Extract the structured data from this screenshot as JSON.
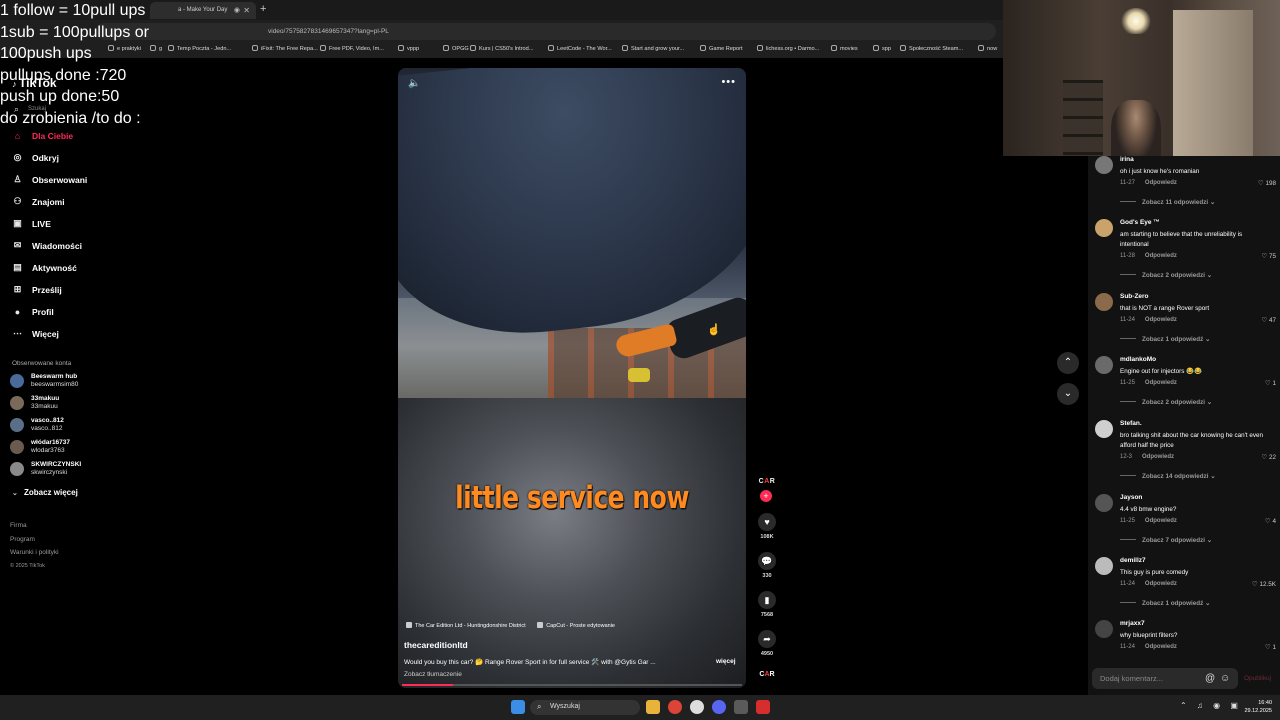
{
  "overlay": {
    "lines": [
      "1 follow = 10pull ups",
      "1sub = 100pullups or",
      "100push ups",
      "pullups done :720",
      "push up done:50",
      "do zrobienia /to do :"
    ]
  },
  "browser": {
    "tab_title": "a - Make Your Day",
    "url": "video/7575827831469657347?lang=pl-PL",
    "bookmarks": [
      "e praktyki",
      "g",
      "Temp Poczta - Jedn...",
      "iFixit: The Free Repa...",
      "Free PDF, Video, Im...",
      "vppp",
      "OPGG",
      "Kurs | CS50's Introd...",
      "LeetCode - The Wor...",
      "Start and grow your...",
      "Game Report",
      "lichess.org • Darmo...",
      "movies",
      "spp",
      "Społeczność Steam...",
      "now"
    ]
  },
  "tiktok": {
    "logo": "TikTok",
    "search_placeholder": "Szukaj",
    "nav": [
      {
        "label": "Dla Ciebie",
        "icon": "home-icon",
        "active": true
      },
      {
        "label": "Odkryj",
        "icon": "compass-icon"
      },
      {
        "label": "Obserwowani",
        "icon": "following-icon"
      },
      {
        "label": "Znajomi",
        "icon": "friends-icon"
      },
      {
        "label": "LIVE",
        "icon": "live-icon"
      },
      {
        "label": "Wiadomości",
        "icon": "messages-icon"
      },
      {
        "label": "Aktywność",
        "icon": "activity-icon"
      },
      {
        "label": "Prześlij",
        "icon": "upload-icon"
      },
      {
        "label": "Profil",
        "icon": "profile-icon"
      },
      {
        "label": "Więcej",
        "icon": "more-icon"
      }
    ],
    "followed_heading": "Obserwowane konta",
    "followed": [
      {
        "name": "Beeswarm hub",
        "handle": "beeswarmsim80"
      },
      {
        "name": "33makuu",
        "handle": "33makuu"
      },
      {
        "name": "vasco..812",
        "handle": "vasco..812"
      },
      {
        "name": "włódar16737",
        "handle": "wlodar3763"
      },
      {
        "name": "SKWIRCZYNSKI",
        "handle": "skwirczynski"
      }
    ],
    "see_more": "Zobacz więcej",
    "footer": [
      "Firma",
      "Program",
      "Warunki i polityki",
      "© 2025 TikTok"
    ]
  },
  "video": {
    "caption_overlay": "little service now",
    "tag1": "The Car Edition Ltd - Huntingdonshire District",
    "tag2": "CapCut - Proste edytowanie",
    "author": "thecareditionltd",
    "description": "Would you buy this car? 🤔 Range Rover Sport in for full service 🛠️ with @Gytis Gar ...",
    "more": "więcej",
    "translate": "Zobacz tłumaczenie",
    "progress": 0.15,
    "likes": "108K",
    "comments": "330",
    "saves": "7568",
    "shares": "4950",
    "channel_logo": "CAR"
  },
  "comments": [
    {
      "user": "irina",
      "text": "oh i just know he's romanian",
      "date": "11-27",
      "likes": "198",
      "replies": "Zobacz 11 odpowiedzi"
    },
    {
      "user": "God's Eye ™",
      "text": "am starting to believe that the unreliability is intentional",
      "date": "11-28",
      "likes": "75",
      "replies": "Zobacz 2 odpowiedzi"
    },
    {
      "user": "Sub-Zero",
      "text": "that is NOT a range Rover sport",
      "date": "11-24",
      "likes": "47",
      "replies": "Zobacz 1 odpowiedź"
    },
    {
      "user": "mdlankoMo",
      "text": "Engine out for injectors 😂😂",
      "date": "11-25",
      "likes": "1",
      "replies": "Zobacz 2 odpowiedzi"
    },
    {
      "user": "Stefan.",
      "text": "bro talking shit about the car knowing he can't even afford half the price",
      "date": "12-3",
      "likes": "22",
      "replies": "Zobacz 14 odpowiedzi"
    },
    {
      "user": "Jayson",
      "text": "4.4 v8 bmw engine?",
      "date": "11-25",
      "likes": "4",
      "replies": "Zobacz 7 odpowiedzi"
    },
    {
      "user": "demillz7",
      "text": "This guy is pure comedy",
      "date": "11-24",
      "likes": "12.5K",
      "replies": "Zobacz 1 odpowiedź"
    },
    {
      "user": "mrjaxx7",
      "text": "why blueprint filters?",
      "date": "11-24",
      "likes": "1",
      "replies": ""
    }
  ],
  "comment_ui": {
    "reply_label": "Odpowiedz",
    "add_placeholder": "Dodaj komentarz...",
    "post": "Opublikuj"
  },
  "taskbar": {
    "search": "Wyszukaj",
    "time": "16:40",
    "date": "29.12.2025"
  }
}
